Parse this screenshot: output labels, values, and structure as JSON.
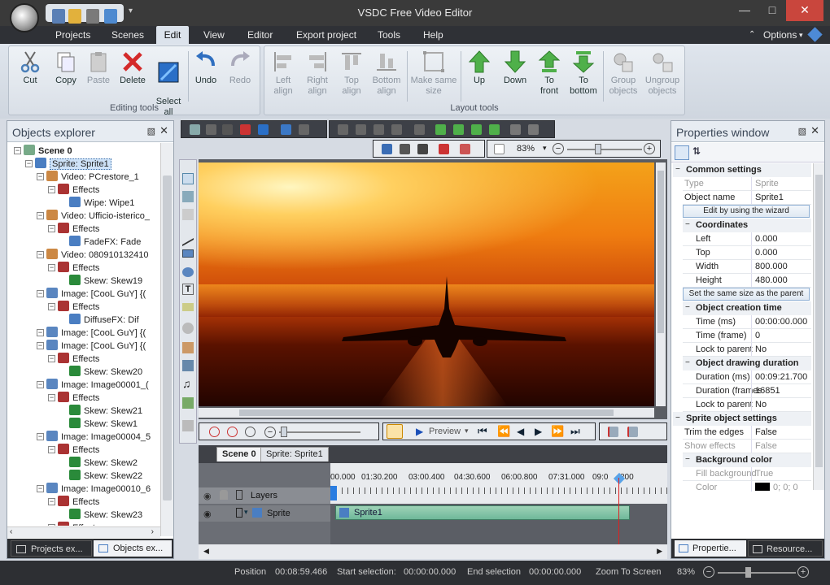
{
  "app": {
    "title": "VSDC Free Video Editor"
  },
  "menu": {
    "items": [
      "Projects",
      "Scenes",
      "Edit",
      "View",
      "Editor",
      "Export project",
      "Tools",
      "Help"
    ],
    "options": "Options"
  },
  "ribbon": {
    "editing": {
      "label": "Editing tools",
      "buttons": [
        "Cut",
        "Copy",
        "Paste",
        "Delete",
        "Select\nall",
        "Undo",
        "Redo"
      ]
    },
    "layout": {
      "label": "Layout tools",
      "buttons": [
        "Left\nalign",
        "Right\nalign",
        "Top\nalign",
        "Bottom\nalign",
        "Make same\nsize",
        "Up",
        "Down",
        "To\nfront",
        "To\nbottom",
        "Group\nobjects",
        "Ungroup\nobjects"
      ]
    }
  },
  "objects_explorer": {
    "title": "Objects explorer",
    "tabs": [
      "Projects ex...",
      "Objects ex..."
    ],
    "tree": [
      {
        "d": 0,
        "t": "Scene 0",
        "bold": true,
        "icon": "scene"
      },
      {
        "d": 1,
        "t": "Sprite: Sprite1",
        "sel": true,
        "icon": "sprite"
      },
      {
        "d": 2,
        "t": "Video: PCrestore_1",
        "icon": "video"
      },
      {
        "d": 3,
        "t": "Effects",
        "icon": "fx"
      },
      {
        "d": 4,
        "t": "Wipe: Wipe1",
        "icon": "wipe"
      },
      {
        "d": 2,
        "t": "Video: Ufficio-isterico_",
        "icon": "video"
      },
      {
        "d": 3,
        "t": "Effects",
        "icon": "fx"
      },
      {
        "d": 4,
        "t": "FadeFX: Fade",
        "icon": "wipe"
      },
      {
        "d": 2,
        "t": "Video: 080910132410",
        "icon": "video"
      },
      {
        "d": 3,
        "t": "Effects",
        "icon": "fx"
      },
      {
        "d": 4,
        "t": "Skew: Skew19",
        "icon": "skew"
      },
      {
        "d": 2,
        "t": "Image: [CooL GuY] {(",
        "icon": "image"
      },
      {
        "d": 3,
        "t": "Effects",
        "icon": "fx"
      },
      {
        "d": 4,
        "t": "DiffuseFX: Dif",
        "icon": "wipe"
      },
      {
        "d": 2,
        "t": "Image: [CooL GuY] {(",
        "icon": "image"
      },
      {
        "d": 2,
        "t": "Image: [CooL GuY] {(",
        "icon": "image"
      },
      {
        "d": 3,
        "t": "Effects",
        "icon": "fx"
      },
      {
        "d": 4,
        "t": "Skew: Skew20",
        "icon": "skew"
      },
      {
        "d": 2,
        "t": "Image: Image00001_(",
        "icon": "image"
      },
      {
        "d": 3,
        "t": "Effects",
        "icon": "fx"
      },
      {
        "d": 4,
        "t": "Skew: Skew21",
        "icon": "skew"
      },
      {
        "d": 4,
        "t": "Skew: Skew1",
        "icon": "skew"
      },
      {
        "d": 2,
        "t": "Image: Image00004_5",
        "icon": "image"
      },
      {
        "d": 3,
        "t": "Effects",
        "icon": "fx"
      },
      {
        "d": 4,
        "t": "Skew: Skew2",
        "icon": "skew"
      },
      {
        "d": 4,
        "t": "Skew: Skew22",
        "icon": "skew"
      },
      {
        "d": 2,
        "t": "Image: Image00010_6",
        "icon": "image"
      },
      {
        "d": 3,
        "t": "Effects",
        "icon": "fx"
      },
      {
        "d": 4,
        "t": "Skew: Skew23",
        "icon": "skew"
      },
      {
        "d": 3,
        "t": "Effects",
        "icon": "fx"
      }
    ]
  },
  "properties": {
    "title": "Properties window",
    "tabs": [
      "Propertie...",
      "Resource..."
    ],
    "rows": [
      {
        "s": "Common settings"
      },
      {
        "k": "Type",
        "v": "Sprite",
        "dis": true
      },
      {
        "k": "Object name",
        "v": "Sprite1"
      },
      {
        "b": "Edit by using the wizard"
      },
      {
        "s": "Coordinates",
        "sub": true
      },
      {
        "k": "Left",
        "v": "0.000",
        "sub": true
      },
      {
        "k": "Top",
        "v": "0.000",
        "sub": true
      },
      {
        "k": "Width",
        "v": "800.000",
        "sub": true
      },
      {
        "k": "Height",
        "v": "480.000",
        "sub": true
      },
      {
        "b": "Set the same size as the parent"
      },
      {
        "s": "Object creation time",
        "sub": true
      },
      {
        "k": "Time (ms)",
        "v": "00:00:00.000",
        "sub": true
      },
      {
        "k": "Time (frame)",
        "v": "0",
        "sub": true
      },
      {
        "k": "Lock to parent",
        "v": "No",
        "sub": true
      },
      {
        "s": "Object drawing duration",
        "sub": true
      },
      {
        "k": "Duration (ms)",
        "v": "00:09:21.700",
        "sub": true
      },
      {
        "k": "Duration (frames)",
        "v": "16851",
        "sub": true
      },
      {
        "k": "Lock to parent",
        "v": "No",
        "sub": true
      },
      {
        "s": "Sprite object settings"
      },
      {
        "k": "Trim the edges",
        "v": "False"
      },
      {
        "k": "Show effects",
        "v": "False",
        "dis": true
      },
      {
        "s": "Background color",
        "sub": true
      },
      {
        "k": "Fill background",
        "v": "True",
        "dis": true,
        "sub": true
      },
      {
        "k": "Color",
        "v": "0; 0; 0",
        "dis": true,
        "sub": true,
        "swatch": "#000000"
      }
    ]
  },
  "preview": {
    "zoom": "83%",
    "label": "Preview"
  },
  "timeline": {
    "tabs": [
      "Scene 0",
      "Sprite: Sprite1"
    ],
    "ruler": [
      "00.000",
      "01:30.200",
      "03:00.400",
      "04:30.600",
      "06:00.800",
      "07:31.000",
      "09:0",
      "200"
    ],
    "layers_label": "Layers",
    "track_label": "Sprite",
    "clip": "Sprite1"
  },
  "status": {
    "position_label": "Position",
    "position": "00:08:59.466",
    "start_label": "Start selection:",
    "start": "00:00:00.000",
    "end_label": "End selection",
    "end": "00:00:00.000",
    "zoom_label": "Zoom To Screen",
    "zoom": "83%"
  },
  "colors": {
    "accent": "#2a7de1",
    "menu_bg": "#2f3136"
  }
}
